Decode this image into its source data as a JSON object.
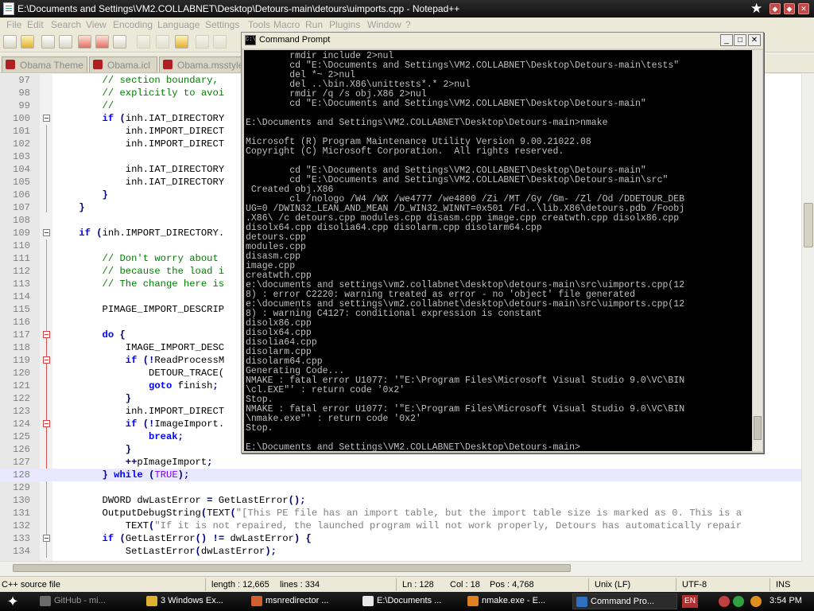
{
  "notepad": {
    "title": "E:\\Documents and Settings\\VM2.COLLABNET\\Desktop\\Detours-main\\detours\\uimports.cpp - Notepad++",
    "menu": [
      "File",
      "Edit",
      "Search",
      "View",
      "Encoding",
      "Language",
      "Settings",
      "Tools",
      "Macro",
      "Run",
      "Plugins",
      "Window",
      "?"
    ],
    "tabs": [
      "Obama Theme",
      "Obama.icl",
      "Obama.msstyles"
    ],
    "code_lines": [
      {
        "n": "97",
        "html": "        <span class=\"c-cm\">// section boundary,</span>"
      },
      {
        "n": "98",
        "html": "        <span class=\"c-cm\">// explicitly to avoi</span>"
      },
      {
        "n": "99",
        "html": "        <span class=\"c-cm\">//</span>"
      },
      {
        "n": "100",
        "html": "        <span class=\"c-kw\">if</span> <span class=\"c-op\">(</span>inh.IAT_DIRECTORY"
      },
      {
        "n": "101",
        "html": "            inh.IMPORT_DIRECT"
      },
      {
        "n": "102",
        "html": "            inh.IMPORT_DIRECT"
      },
      {
        "n": "103",
        "html": ""
      },
      {
        "n": "104",
        "html": "            inh.IAT_DIRECTORY"
      },
      {
        "n": "105",
        "html": "            inh.IAT_DIRECTORY"
      },
      {
        "n": "106",
        "html": "        <span class=\"c-op\">}</span>"
      },
      {
        "n": "107",
        "html": "    <span class=\"c-op\">}</span>"
      },
      {
        "n": "108",
        "html": ""
      },
      {
        "n": "109",
        "html": "    <span class=\"c-kw\">if</span> <span class=\"c-op\">(</span>inh.IMPORT_DIRECTORY."
      },
      {
        "n": "110",
        "html": ""
      },
      {
        "n": "111",
        "html": "        <span class=\"c-cm\">// Don't worry about</span>"
      },
      {
        "n": "112",
        "html": "        <span class=\"c-cm\">// because the load i</span>"
      },
      {
        "n": "113",
        "html": "        <span class=\"c-cm\">// The change here is</span>"
      },
      {
        "n": "114",
        "html": ""
      },
      {
        "n": "115",
        "html": "        PIMAGE_IMPORT_DESCRIP                                                               alAddr"
      },
      {
        "n": "116",
        "html": ""
      },
      {
        "n": "117",
        "html": "        <span class=\"c-kw\">do</span> <span class=\"c-op\">{</span>"
      },
      {
        "n": "118",
        "html": "            IMAGE_IMPORT_DESC"
      },
      {
        "n": "119",
        "html": "            <span class=\"c-kw\">if</span> <span class=\"c-op\">(!</span>ReadProcessM"
      },
      {
        "n": "120",
        "html": "                DETOUR_TRACE("
      },
      {
        "n": "121",
        "html": "                <span class=\"c-kw\">goto</span> finish<span class=\"c-op\">;</span>"
      },
      {
        "n": "122",
        "html": "            <span class=\"c-op\">}</span>"
      },
      {
        "n": "123",
        "html": "            inh.IMPORT_DIRECT"
      },
      {
        "n": "124",
        "html": "            <span class=\"c-kw\">if</span> <span class=\"c-op\">(!</span>ImageImport."
      },
      {
        "n": "125",
        "html": "                <span class=\"c-kw\">break</span><span class=\"c-op\">;</span>"
      },
      {
        "n": "126",
        "html": "            <span class=\"c-op\">}</span>"
      },
      {
        "n": "127",
        "html": "            <span class=\"c-op\">++</span>pImageImport<span class=\"c-op\">;</span>"
      },
      {
        "n": "128",
        "html": "        <span class=\"c-op\">}</span> <span class=\"c-kw\">while</span> <span class=\"c-op\">(</span><span class=\"c-kw2\">TRUE</span><span class=\"c-op\">);</span>"
      },
      {
        "n": "129",
        "html": ""
      },
      {
        "n": "130",
        "html": "        DWORD dwLastError <span class=\"c-op\">=</span> GetLastError<span class=\"c-op\">();</span>"
      },
      {
        "n": "131",
        "html": "        OutputDebugString<span class=\"c-op\">(</span>TEXT<span class=\"c-op\">(</span><span class=\"c-st\">\"[This PE file has an import table, but the import table size is marked as 0. This is a</span>"
      },
      {
        "n": "132",
        "html": "            TEXT<span class=\"c-op\">(</span><span class=\"c-st\">\"If it is not repaired, the launched program will not work properly, Detours has automatically repair</span>"
      },
      {
        "n": "133",
        "html": "        <span class=\"c-kw\">if</span> <span class=\"c-op\">(</span>GetLastError<span class=\"c-op\">() !=</span> dwLastError<span class=\"c-op\">) {</span>"
      },
      {
        "n": "134",
        "html": "            SetLastError<span class=\"c-op\">(</span>dwLastError<span class=\"c-op\">);</span>"
      }
    ],
    "status": {
      "file_type": "C++ source file",
      "length": "length : 12,665",
      "lines": "lines : 334",
      "ln": "Ln : 128",
      "col": "Col : 18",
      "pos": "Pos : 4,768",
      "eol": "Unix (LF)",
      "encoding": "UTF-8",
      "ins": "INS"
    }
  },
  "cmd": {
    "title": "Command Prompt",
    "lines": [
      "        rmdir include 2>nul",
      "        cd \"E:\\Documents and Settings\\VM2.COLLABNET\\Desktop\\Detours-main\\tests\"",
      "        del *~ 2>nul",
      "        del ..\\bin.X86\\unittests*.* 2>nul",
      "        rmdir /q /s obj.X86 2>nul",
      "        cd \"E:\\Documents and Settings\\VM2.COLLABNET\\Desktop\\Detours-main\"",
      "",
      "E:\\Documents and Settings\\VM2.COLLABNET\\Desktop\\Detours-main>nmake",
      "",
      "Microsoft (R) Program Maintenance Utility Version 9.00.21022.08",
      "Copyright (C) Microsoft Corporation.  All rights reserved.",
      "",
      "        cd \"E:\\Documents and Settings\\VM2.COLLABNET\\Desktop\\Detours-main\"",
      "        cd \"E:\\Documents and Settings\\VM2.COLLABNET\\Desktop\\Detours-main\\src\"",
      " Created obj.X86",
      "        cl /nologo /W4 /WX /we4777 /we4800 /Zi /MT /Gy /Gm- /Zl /Od /DDETOUR_DEB",
      "UG=0 /DWIN32_LEAN_AND_MEAN /D_WIN32_WINNT=0x501 /Fd..\\lib.X86\\detours.pdb /Foobj",
      ".X86\\ /c detours.cpp modules.cpp disasm.cpp image.cpp creatwth.cpp disolx86.cpp",
      "disolx64.cpp disolia64.cpp disolarm.cpp disolarm64.cpp",
      "detours.cpp",
      "modules.cpp",
      "disasm.cpp",
      "image.cpp",
      "creatwth.cpp",
      "e:\\documents and settings\\vm2.collabnet\\desktop\\detours-main\\src\\uimports.cpp(12",
      "8) : error C2220: warning treated as error - no 'object' file generated",
      "e:\\documents and settings\\vm2.collabnet\\desktop\\detours-main\\src\\uimports.cpp(12",
      "8) : warning C4127: conditional expression is constant",
      "disolx86.cpp",
      "disolx64.cpp",
      "disolia64.cpp",
      "disolarm.cpp",
      "disolarm64.cpp",
      "Generating Code...",
      "NMAKE : fatal error U1077: '\"E:\\Program Files\\Microsoft Visual Studio 9.0\\VC\\BIN",
      "\\cl.EXE\"' : return code '0x2'",
      "Stop.",
      "NMAKE : fatal error U1077: '\"E:\\Program Files\\Microsoft Visual Studio 9.0\\VC\\BIN",
      "\\nmake.exe\"' : return code '0x2'",
      "Stop.",
      "",
      "E:\\Documents and Settings\\VM2.COLLABNET\\Desktop\\Detours-main>"
    ]
  },
  "taskbar": {
    "items": [
      {
        "label": "GitHub - mi...",
        "icon_color": "#6a6a6a",
        "dim": true
      },
      {
        "label": "3 Windows Ex...",
        "icon_color": "#e0b030",
        "dim": false
      },
      {
        "label": "msnredirector ...",
        "icon_color": "#d06030",
        "dim": false
      },
      {
        "label": "E:\\Documents ...",
        "icon_color": "#e8e8e8",
        "dim": false
      },
      {
        "label": "nmake.exe - E...",
        "icon_color": "#e08020",
        "dim": false
      },
      {
        "label": "Command Pro...",
        "icon_color": "#3070c0",
        "dim": false
      }
    ],
    "lang": "EN",
    "clock": "3:54 PM"
  }
}
